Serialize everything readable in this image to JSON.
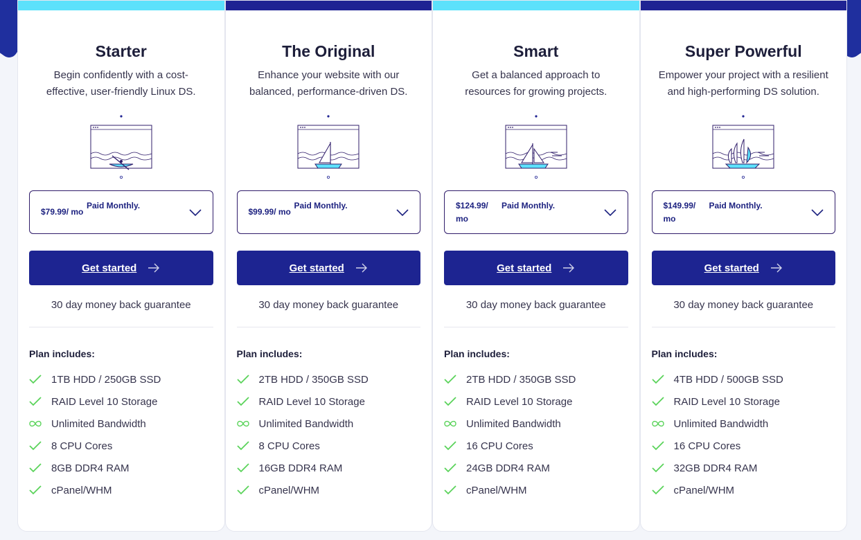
{
  "colors": {
    "accent_light": "#5ce1fb",
    "accent_dark": "#1f2393",
    "button": "#1d2491",
    "check": "#5ad35a"
  },
  "plans": [
    {
      "name": "Starter",
      "description": "Begin confidently with a cost-effective, user-friendly Linux DS.",
      "illustration": "rowboat-icon",
      "top_color": "light",
      "price": "$79.99/ mo",
      "billing": "Paid Monthly.",
      "cta": "Get started",
      "guarantee": "30 day money back guarantee",
      "includes_title": "Plan includes:",
      "features": [
        {
          "icon": "check-icon",
          "label": "1TB HDD / 250GB SSD"
        },
        {
          "icon": "check-icon",
          "label": "RAID Level 10 Storage"
        },
        {
          "icon": "infinity-icon",
          "label": "Unlimited Bandwidth"
        },
        {
          "icon": "check-icon",
          "label": "8 CPU Cores"
        },
        {
          "icon": "check-icon",
          "label": "8GB DDR4 RAM"
        },
        {
          "icon": "check-icon",
          "label": "cPanel/WHM"
        }
      ]
    },
    {
      "name": "The Original",
      "description": "Enhance your website with our balanced, performance-driven DS.",
      "illustration": "sailboat-icon",
      "top_color": "dark",
      "price": "$99.99/ mo",
      "billing": "Paid Monthly.",
      "cta": "Get started",
      "guarantee": "30 day money back guarantee",
      "includes_title": "Plan includes:",
      "features": [
        {
          "icon": "check-icon",
          "label": "2TB HDD / 350GB SSD"
        },
        {
          "icon": "check-icon",
          "label": "RAID Level 10 Storage"
        },
        {
          "icon": "infinity-icon",
          "label": "Unlimited Bandwidth"
        },
        {
          "icon": "check-icon",
          "label": "8 CPU Cores"
        },
        {
          "icon": "check-icon",
          "label": "16GB DDR4 RAM"
        },
        {
          "icon": "check-icon",
          "label": "cPanel/WHM"
        }
      ]
    },
    {
      "name": "Smart",
      "description": "Get a balanced approach to resources for growing projects.",
      "illustration": "speedy-sailboat-icon",
      "top_color": "light",
      "price": "$124.99/ mo",
      "billing": "Paid Monthly.",
      "cta": "Get started",
      "guarantee": "30 day money back guarantee",
      "includes_title": "Plan includes:",
      "features": [
        {
          "icon": "check-icon",
          "label": "2TB HDD / 350GB SSD"
        },
        {
          "icon": "check-icon",
          "label": "RAID Level 10 Storage"
        },
        {
          "icon": "infinity-icon",
          "label": "Unlimited Bandwidth"
        },
        {
          "icon": "check-icon",
          "label": "16 CPU Cores"
        },
        {
          "icon": "check-icon",
          "label": "24GB DDR4 RAM"
        },
        {
          "icon": "check-icon",
          "label": "cPanel/WHM"
        }
      ]
    },
    {
      "name": "Super Powerful",
      "description": "Empower your project with a resilient and high-performing DS solution.",
      "illustration": "galleon-icon",
      "top_color": "dark",
      "price": "$149.99/ mo",
      "billing": "Paid Monthly.",
      "cta": "Get started",
      "guarantee": "30 day money back guarantee",
      "includes_title": "Plan includes:",
      "features": [
        {
          "icon": "check-icon",
          "label": "4TB HDD / 500GB SSD"
        },
        {
          "icon": "check-icon",
          "label": "RAID Level 10 Storage"
        },
        {
          "icon": "infinity-icon",
          "label": "Unlimited Bandwidth"
        },
        {
          "icon": "check-icon",
          "label": "16 CPU Cores"
        },
        {
          "icon": "check-icon",
          "label": "32GB DDR4 RAM"
        },
        {
          "icon": "check-icon",
          "label": "cPanel/WHM"
        }
      ]
    }
  ]
}
